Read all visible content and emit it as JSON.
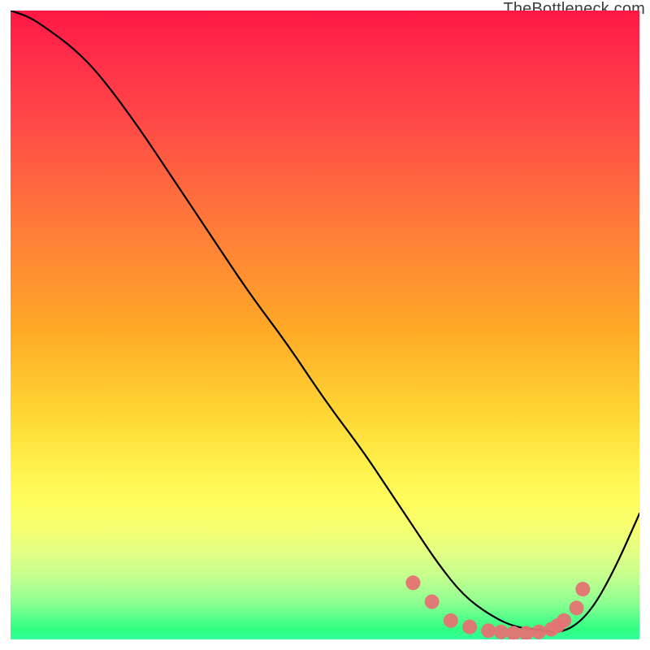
{
  "watermark": "TheBottleneck.com",
  "chart_data": {
    "type": "line",
    "title": "",
    "xlabel": "",
    "ylabel": "",
    "xlim": [
      0,
      100
    ],
    "ylim": [
      0,
      100
    ],
    "grid": false,
    "series": [
      {
        "name": "curve",
        "x": [
          0,
          3,
          6,
          10,
          14,
          20,
          26,
          32,
          38,
          44,
          50,
          56,
          60,
          64,
          68,
          72,
          76,
          80,
          84,
          88,
          92,
          96,
          100
        ],
        "y": [
          100,
          99,
          97,
          94,
          90,
          82,
          73,
          64,
          55,
          47,
          38,
          30,
          24,
          18,
          12,
          7,
          4,
          2,
          1.5,
          1,
          4,
          11,
          20
        ]
      }
    ],
    "markers": {
      "name": "dots",
      "color": "#e57373",
      "x": [
        64,
        67,
        70,
        73,
        76,
        78,
        80,
        82,
        84,
        86,
        87,
        88,
        90,
        91
      ],
      "y": [
        9,
        6,
        3,
        2,
        1.4,
        1.2,
        1.0,
        1.0,
        1.2,
        1.6,
        2.2,
        3.0,
        5.0,
        8.0
      ]
    },
    "background": {
      "type": "vertical-gradient",
      "stops": [
        {
          "offset": 0,
          "color": "#ff1744"
        },
        {
          "offset": 50,
          "color": "#ffa726"
        },
        {
          "offset": 78,
          "color": "#fffd5d"
        },
        {
          "offset": 100,
          "color": "#33ff99"
        }
      ]
    }
  }
}
